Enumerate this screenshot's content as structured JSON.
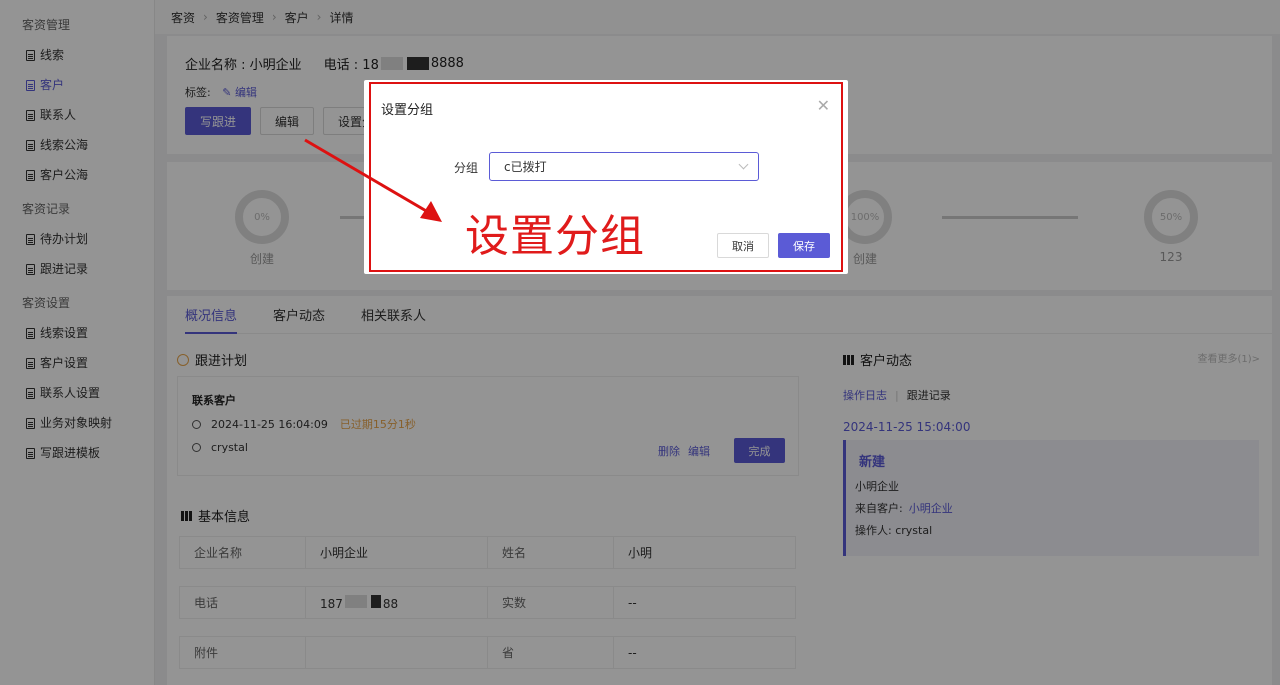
{
  "sidebar": {
    "groups": [
      {
        "label": "客资管理",
        "items": [
          "线索",
          "客户",
          "联系人",
          "线索公海",
          "客户公海"
        ]
      },
      {
        "label": "客资记录",
        "items": [
          "待办计划",
          "跟进记录"
        ]
      },
      {
        "label": "客资设置",
        "items": [
          "线索设置",
          "客户设置",
          "联系人设置",
          "业务对象映射",
          "写跟进模板"
        ]
      }
    ]
  },
  "breadcrumb": [
    "客资",
    "客资管理",
    "客户",
    "详情"
  ],
  "header": {
    "company_label": "企业名称 : 小明企业",
    "phone_prefix": "电话 : 18",
    "phone_suffix": "8888",
    "tags_label": "标签:",
    "tags_edit": "编辑",
    "buttons": {
      "write": "写跟进",
      "edit": "编辑",
      "group": "设置分"
    }
  },
  "progress": {
    "steps": [
      {
        "percent": "0%",
        "label": "创建"
      },
      {
        "percent": "100%",
        "label": "创建"
      },
      {
        "percent": "50%",
        "label": "123"
      }
    ]
  },
  "tabs": [
    "概况信息",
    "客户动态",
    "相关联系人"
  ],
  "plan": {
    "title": "跟进计划",
    "item_title": "联系客户",
    "time": "2024-11-25 16:04:09",
    "overdue": "已过期15分1秒",
    "user": "crystal",
    "delete": "删除",
    "edit": "编辑",
    "done": "完成"
  },
  "basic": {
    "title": "基本信息",
    "rows": [
      {
        "k1": "企业名称",
        "v1": "小明企业",
        "k2": "姓名",
        "v2": "小明"
      },
      {
        "k1": "电话",
        "v1_prefix": "187",
        "v1_suffix": "88",
        "k2": "实数",
        "v2": "--"
      },
      {
        "k1": "附件",
        "v1": "",
        "k2": "省",
        "v2": "--"
      }
    ]
  },
  "dynamics": {
    "title": "客户动态",
    "more": "查看更多(1)>",
    "tab_log": "操作日志",
    "tab_follow": "跟进记录",
    "date": "2024-11-25 15:04:00",
    "entry_title": "新建",
    "entry_company": "小明企业",
    "from_label": "来自客户:",
    "from_value": "小明企业",
    "operator": "操作人: crystal"
  },
  "modal": {
    "title": "设置分组",
    "field_label": "分组",
    "selected": "c已拨打",
    "cancel": "取消",
    "save": "保存"
  },
  "annotation": {
    "text": "设置分组",
    "color": "#e01b1b"
  },
  "colors": {
    "accent": "#5b5bd6",
    "warning": "#e8a54b"
  }
}
